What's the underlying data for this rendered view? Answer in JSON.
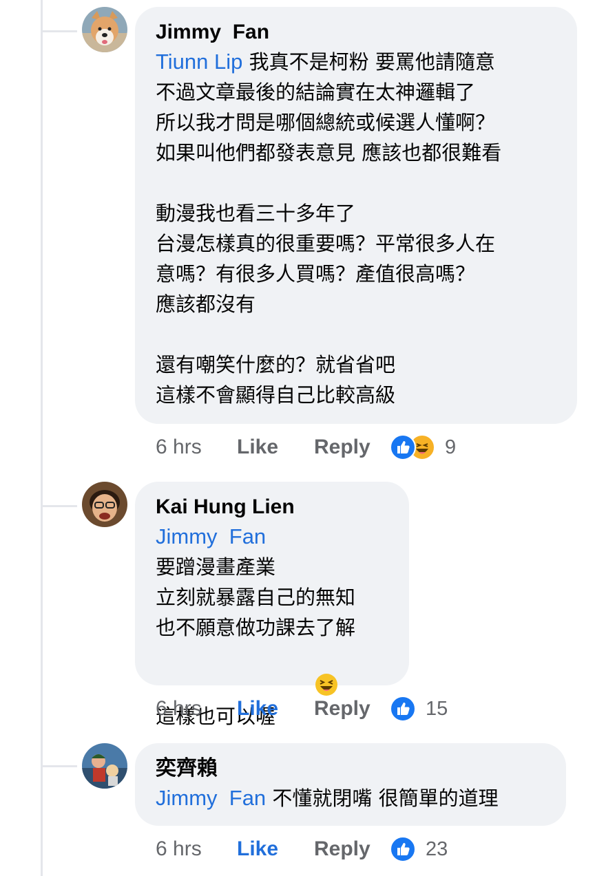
{
  "comments": [
    {
      "author": "Jimmy  Fan",
      "mention": "Tiunn Lip",
      "first_line_rest": " 我真不是柯粉 要罵他請隨意",
      "lines": [
        "不過文章最後的結論實在太神邏輯了",
        "所以我才問是哪個總統或候選人懂啊？",
        "如果叫他們都發表意見 應該也都很難看"
      ],
      "paragraph2": [
        "動漫我也看三十多年了",
        "台漫怎樣真的很重要嗎？平常很多人在",
        "意嗎？有很多人買嗎？產值很高嗎？",
        "應該都沒有"
      ],
      "paragraph3": [
        "還有嘲笑什麼的？就省省吧",
        "這樣不會顯得自己比較高級"
      ],
      "time": "6 hrs",
      "like_label": "Like",
      "reply_label": "Reply",
      "reaction_icons": [
        "like-icon",
        "haha-icon"
      ],
      "reaction_count": "9"
    },
    {
      "author": "Kai Hung Lien",
      "mention": "Jimmy  Fan",
      "lines": [
        "要蹭漫畫產業",
        "立刻就暴露自己的無知",
        "也不願意做功課去了解",
        "這樣也可以喔"
      ],
      "trailing_emoji": "laughing-squint-emoji",
      "time": "6 hrs",
      "like_label": "Like",
      "reply_label": "Reply",
      "reaction_icons": [
        "like-icon"
      ],
      "reaction_count": "15"
    },
    {
      "author": "奕齊賴",
      "mention": "Jimmy  Fan",
      "first_line_rest": " 不懂就閉嘴 很簡單的道理",
      "time": "6 hrs",
      "like_label": "Like",
      "reply_label": "Reply",
      "reaction_icons": [
        "like-icon"
      ],
      "reaction_count": "23"
    }
  ],
  "colors": {
    "mention": "#216fdb",
    "like_active": "#216fdb",
    "bubble": "#f0f2f5",
    "meta": "#65676b",
    "thread_line": "#e4e6eb"
  }
}
